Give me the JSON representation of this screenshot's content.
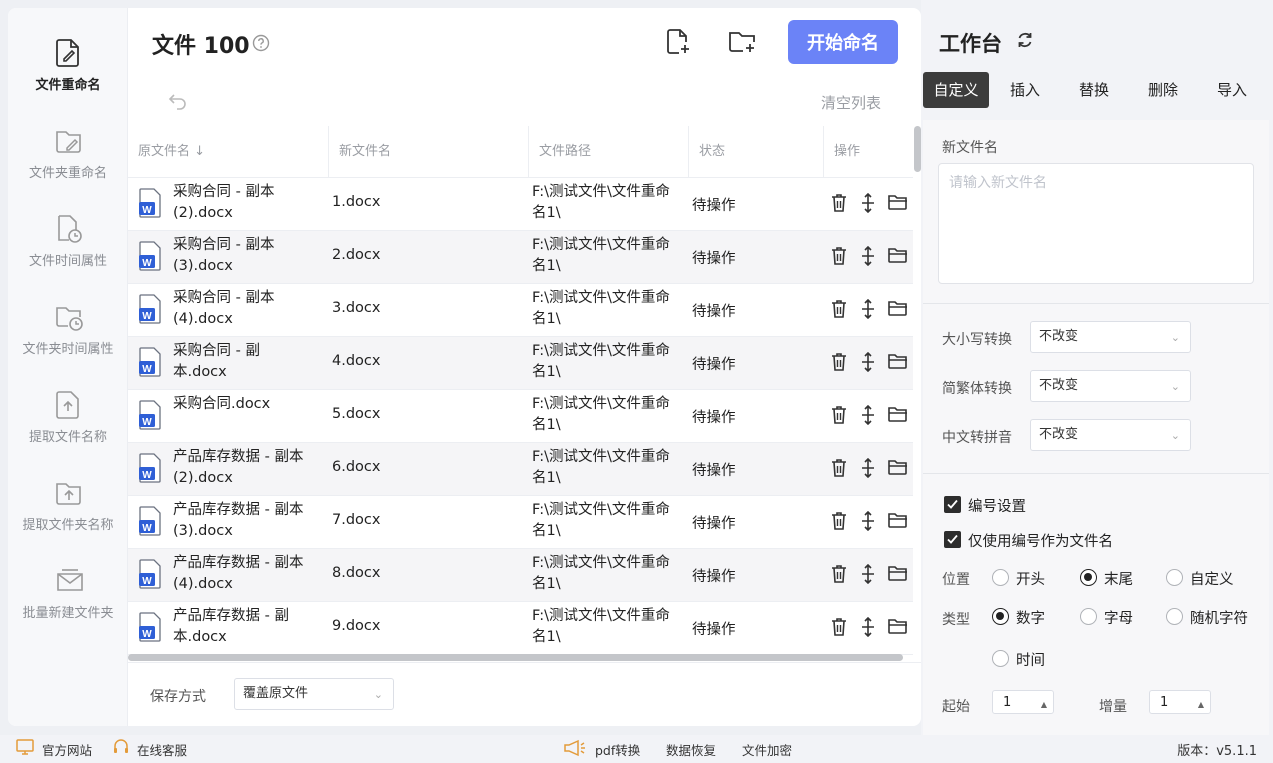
{
  "sidebar": {
    "items": [
      {
        "label": "文件重命名",
        "icon": "file-edit-icon",
        "active": true
      },
      {
        "label": "文件夹重命名",
        "icon": "folder-edit-icon",
        "active": false
      },
      {
        "label": "文件时间属性",
        "icon": "file-clock-icon",
        "active": false
      },
      {
        "label": "文件夹时间属性",
        "icon": "folder-clock-icon",
        "active": false
      },
      {
        "label": "提取文件名称",
        "icon": "file-upload-icon",
        "active": false
      },
      {
        "label": "提取文件夹名称",
        "icon": "folder-upload-icon",
        "active": false
      },
      {
        "label": "批量新建文件夹",
        "icon": "mail-folder-icon",
        "active": false
      }
    ]
  },
  "header": {
    "title": "文件 100",
    "start_label": "开始命名",
    "clear_label": "清空列表"
  },
  "table": {
    "columns": [
      "原文件名",
      "新文件名",
      "文件路径",
      "状态",
      "操作"
    ],
    "rows": [
      {
        "original": "采购合同 - 副本 (2).docx",
        "new": "1.docx",
        "path": "F:\\测试文件\\文件重命名1\\",
        "status": "待操作"
      },
      {
        "original": "采购合同 - 副本 (3).docx",
        "new": "2.docx",
        "path": "F:\\测试文件\\文件重命名1\\",
        "status": "待操作"
      },
      {
        "original": "采购合同 - 副本 (4).docx",
        "new": "3.docx",
        "path": "F:\\测试文件\\文件重命名1\\",
        "status": "待操作"
      },
      {
        "original": "采购合同 - 副本.docx",
        "new": "4.docx",
        "path": "F:\\测试文件\\文件重命名1\\",
        "status": "待操作"
      },
      {
        "original": "采购合同.docx",
        "new": "5.docx",
        "path": "F:\\测试文件\\文件重命名1\\",
        "status": "待操作"
      },
      {
        "original": "产品库存数据 - 副本 (2).docx",
        "new": "6.docx",
        "path": "F:\\测试文件\\文件重命名1\\",
        "status": "待操作"
      },
      {
        "original": "产品库存数据 - 副本 (3).docx",
        "new": "7.docx",
        "path": "F:\\测试文件\\文件重命名1\\",
        "status": "待操作"
      },
      {
        "original": "产品库存数据 - 副本 (4).docx",
        "new": "8.docx",
        "path": "F:\\测试文件\\文件重命名1\\",
        "status": "待操作"
      },
      {
        "original": "产品库存数据 - 副本.docx",
        "new": "9.docx",
        "path": "F:\\测试文件\\文件重命名1\\",
        "status": "待操作"
      }
    ]
  },
  "save": {
    "label": "保存方式",
    "value": "覆盖原文件"
  },
  "workbench": {
    "title": "工作台",
    "tabs": [
      "自定义",
      "插入",
      "替换",
      "删除",
      "导入"
    ],
    "active_tab": 0,
    "new_name_label": "新文件名",
    "new_name_placeholder": "请输入新文件名",
    "case_label": "大小写转换",
    "case_value": "不改变",
    "trad_label": "简繁体转换",
    "trad_value": "不改变",
    "pinyin_label": "中文转拼音",
    "pinyin_value": "不改变",
    "numbering_label": "编号设置",
    "numbering_checked": true,
    "only_number_label": "仅使用编号作为文件名",
    "only_number_checked": true,
    "position_label": "位置",
    "position_options": [
      "开头",
      "末尾",
      "自定义"
    ],
    "position_selected": 1,
    "type_label": "类型",
    "type_options": [
      "数字",
      "字母",
      "随机字符",
      "时间"
    ],
    "type_selected": 0,
    "start_label": "起始",
    "start_value": "1",
    "step_label": "增量",
    "step_value": "1"
  },
  "statusbar": {
    "website": "官方网站",
    "support": "在线客服",
    "pdf": "pdf转换",
    "recovery": "数据恢复",
    "encrypt": "文件加密",
    "version": "版本：v5.1.1"
  },
  "colors": {
    "accent": "#6b83f7",
    "word_blue": "#2f5fd6",
    "tab_active": "#3c3c3c"
  }
}
